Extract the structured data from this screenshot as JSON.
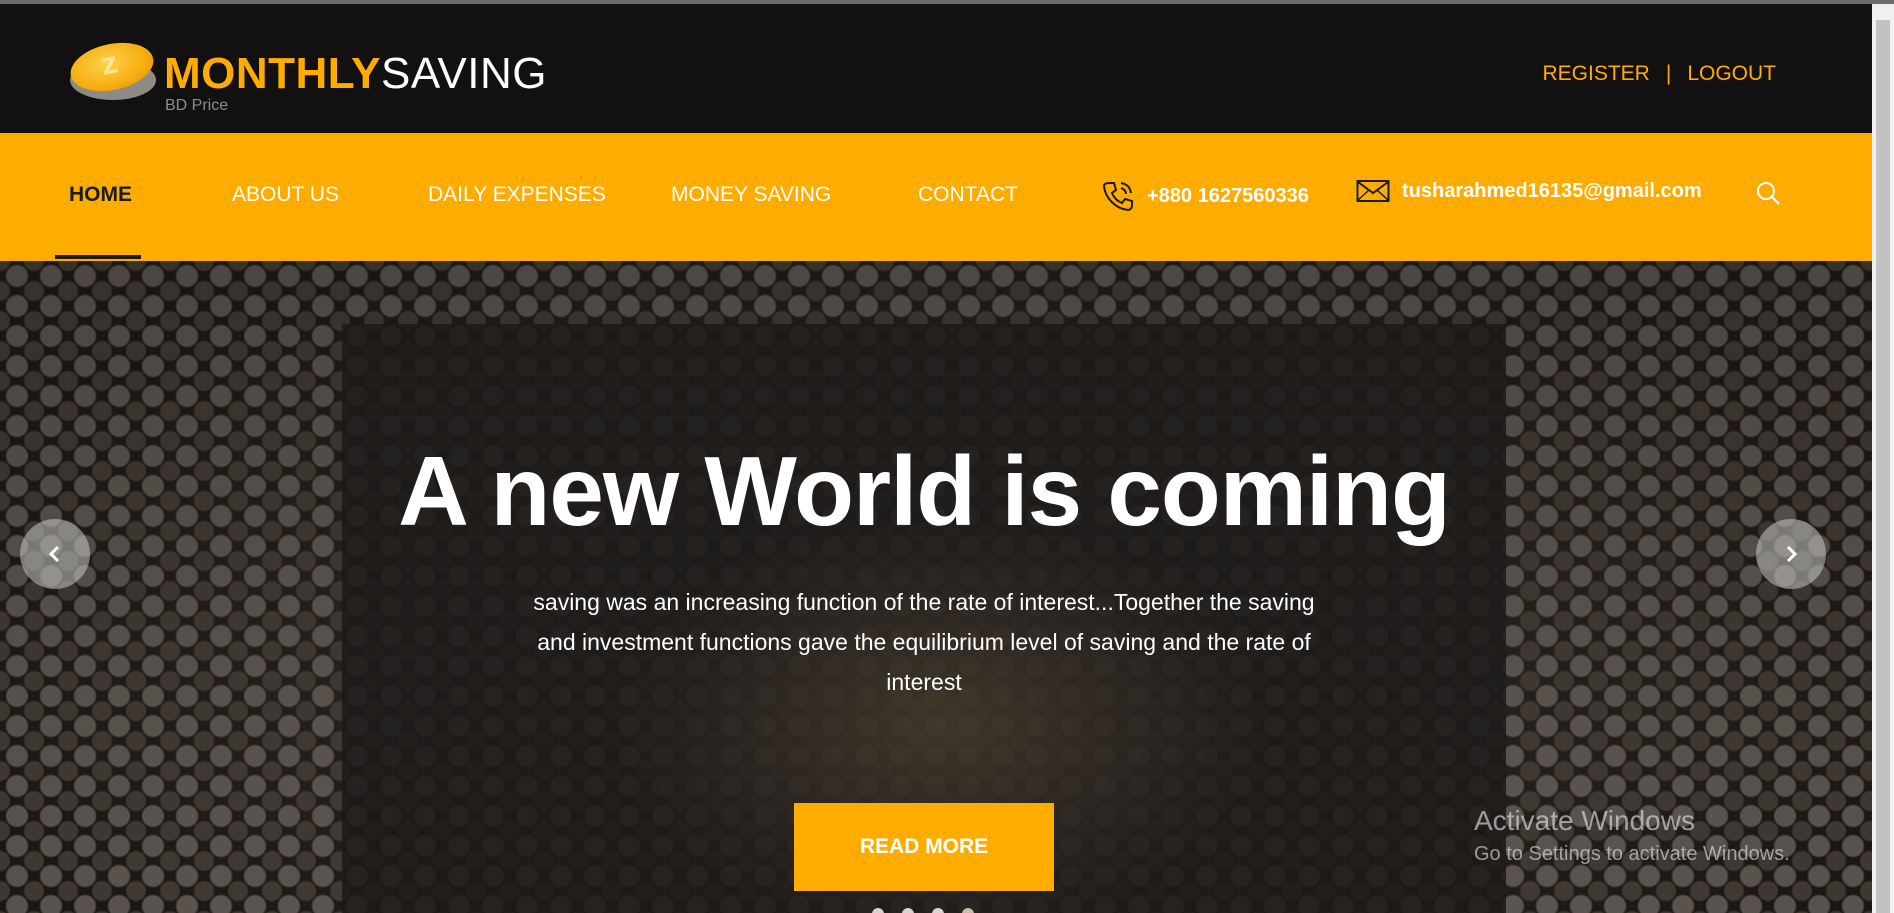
{
  "logo": {
    "text_primary": "MONTHLY",
    "text_secondary": "SAVING",
    "subtitle": "BD Price",
    "icon": "coin-icon"
  },
  "auth": {
    "register": "REGISTER",
    "separator": "|",
    "logout": "LOGOUT"
  },
  "nav": {
    "items": [
      {
        "label": "HOME",
        "active": true
      },
      {
        "label": "ABOUT US",
        "active": false
      },
      {
        "label": "DAILY EXPENSES",
        "active": false
      },
      {
        "label": "MONEY SAVING",
        "active": false
      },
      {
        "label": "CONTACT",
        "active": false
      }
    ],
    "phone": "+880 1627560336",
    "email": "tusharahmed16135@gmail.com",
    "phone_icon": "phone-icon",
    "email_icon": "envelope-icon",
    "search_icon": "search-icon"
  },
  "hero": {
    "headline": "A new World is coming",
    "description": "saving was an increasing function of the rate of interest...Together the saving and investment functions gave the equilibrium level of saving and the rate of interest",
    "cta": "READ MORE",
    "slides": 4,
    "prev_icon": "chevron-left-icon",
    "next_icon": "chevron-right-icon"
  },
  "watermark": {
    "title": "Activate Windows",
    "subtitle": "Go to Settings to activate Windows."
  },
  "colors": {
    "accent": "#ffac00",
    "header_bg": "#121010",
    "text_dark": "#1b1b1b"
  }
}
